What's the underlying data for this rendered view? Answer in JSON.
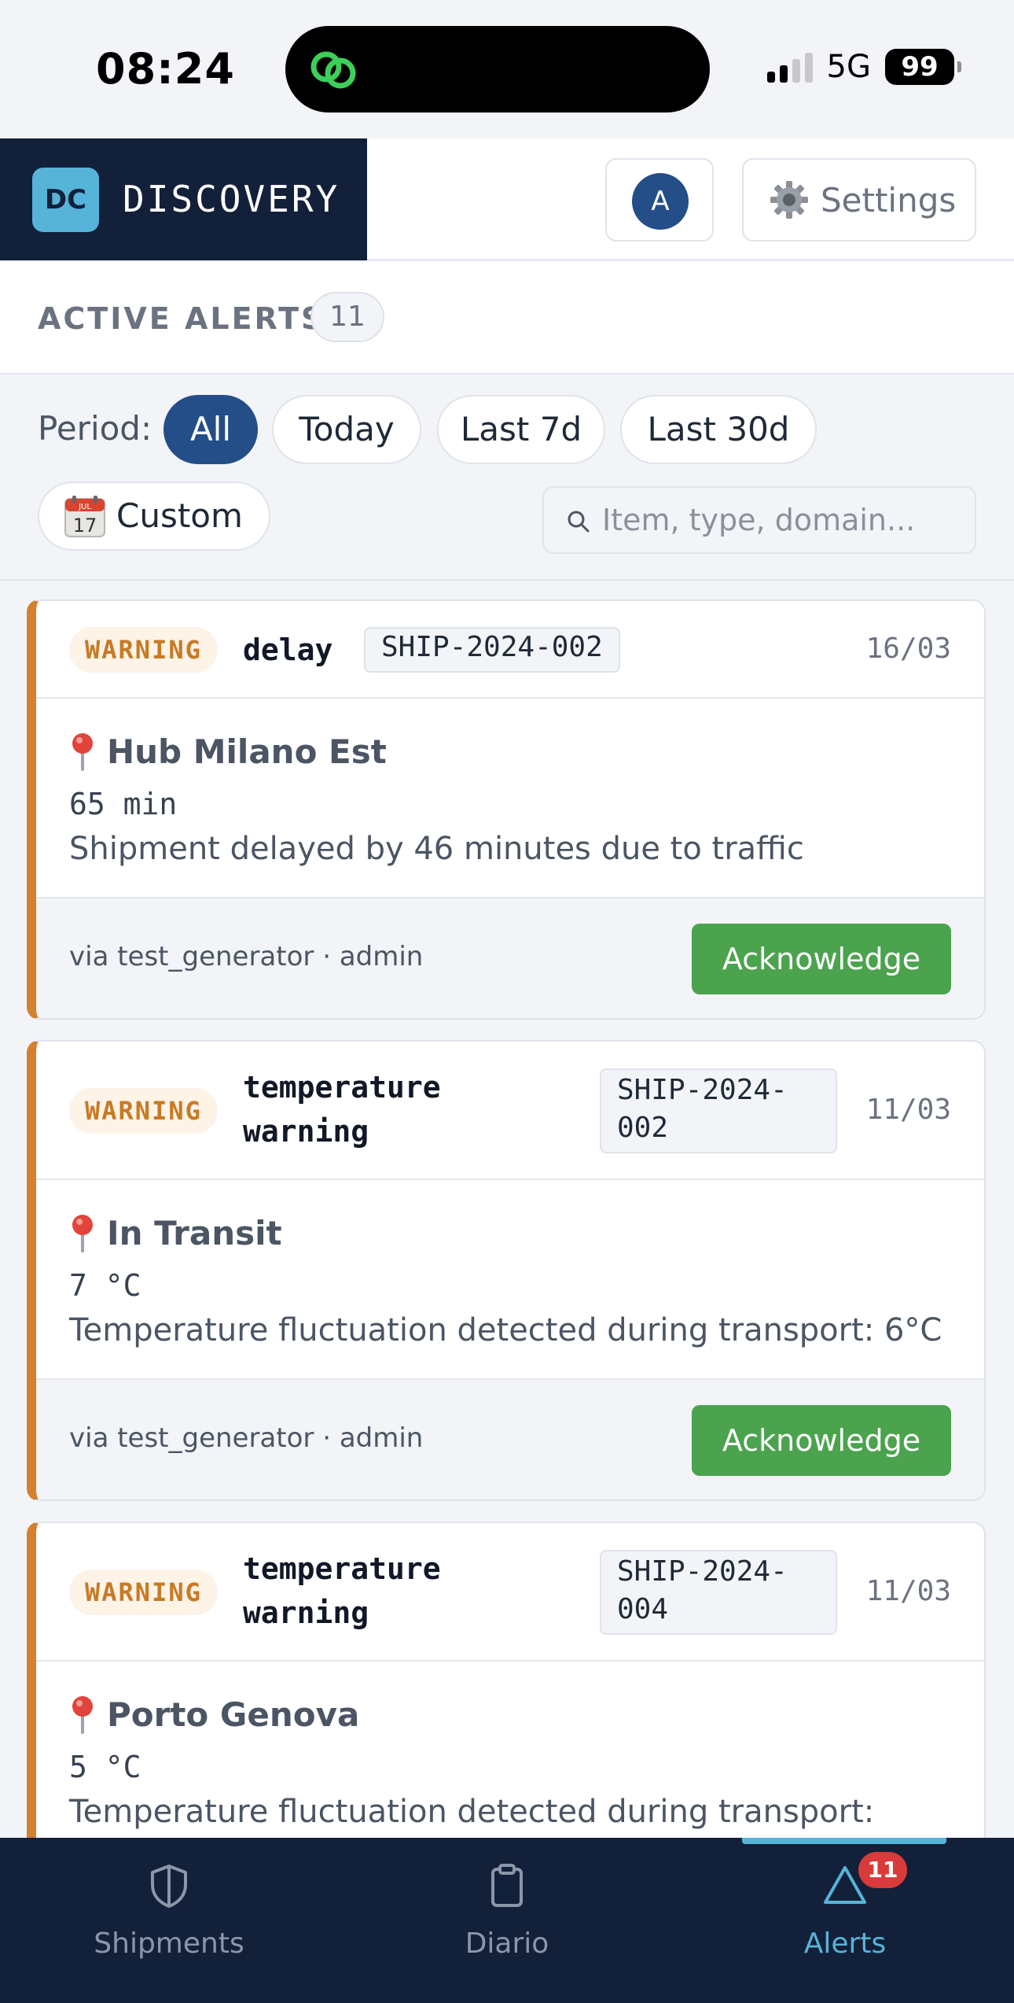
{
  "status_bar": {
    "time": "08:24",
    "network": "5G",
    "battery": "99"
  },
  "brand": {
    "badge": "DC",
    "name": "DISCOVERY"
  },
  "header": {
    "avatar_initial": "A",
    "settings_label": "Settings"
  },
  "alerts_header": {
    "title": "ACTIVE ALERTS",
    "count": "11"
  },
  "filters": {
    "period_label": "Period:",
    "chips": [
      "All",
      "Today",
      "Last 7d",
      "Last 30d"
    ],
    "active_chip": "All",
    "custom_label": "Custom",
    "calendar_month": "JUL",
    "calendar_day": "17",
    "search_placeholder": "Item, type, domain..."
  },
  "alerts": [
    {
      "severity": "WARNING",
      "type": "delay",
      "shipment": "SHIP-2024-002",
      "date": "16/03",
      "location": "Hub Milano Est",
      "value": "65 min",
      "message": "Shipment delayed by 46 minutes due to traffic",
      "source": "via test_generator · admin",
      "action": "Acknowledge"
    },
    {
      "severity": "WARNING",
      "type_line1": "temperature",
      "type_line2": "warning",
      "shipment_line1": "SHIP-2024-",
      "shipment_line2": "002",
      "date": "11/03",
      "location": "In Transit",
      "value": "7 °C",
      "message": "Temperature fluctuation detected during transport: 6°C",
      "source": "via test_generator · admin",
      "action": "Acknowledge"
    },
    {
      "severity": "WARNING",
      "type_line1": "temperature",
      "type_line2": "warning",
      "shipment_line1": "SHIP-2024-",
      "shipment_line2": "004",
      "date": "11/03",
      "location": "Porto Genova",
      "value": "5 °C",
      "message": "Temperature fluctuation detected during transport:"
    }
  ],
  "nav": {
    "items": [
      {
        "label": "Shipments",
        "icon": "shield-icon"
      },
      {
        "label": "Diario",
        "icon": "clipboard-icon"
      },
      {
        "label": "Alerts",
        "icon": "warning-triangle-icon",
        "badge": "11"
      }
    ],
    "active": "Alerts"
  },
  "colors": {
    "brand_dark": "#13203a",
    "accent": "#56b4d8",
    "primary": "#234e87",
    "warning": "#d3802f",
    "success": "#4ba34d",
    "danger": "#d93a3a"
  }
}
